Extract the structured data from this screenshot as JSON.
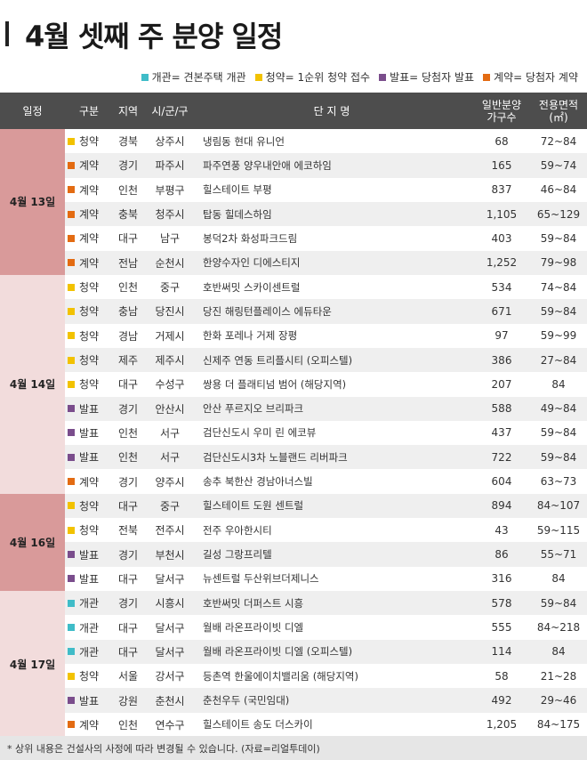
{
  "title": "4월 셋째 주 분양 일정",
  "legend": [
    {
      "color": "#3fbcc8",
      "label": "개관= 견본주택 개관"
    },
    {
      "color": "#f2c200",
      "label": "청약= 1순위 청약 접수"
    },
    {
      "color": "#7a4d8c",
      "label": "발표= 당첨자 발표"
    },
    {
      "color": "#e36b12",
      "label": "계약= 당첨자 계약"
    }
  ],
  "type_colors": {
    "개관": "#3fbcc8",
    "청약": "#f2c200",
    "발표": "#7a4d8c",
    "계약": "#e36b12"
  },
  "headers": {
    "date": "일정",
    "type": "구분",
    "region": "지역",
    "city": "시/군/구",
    "name": "단 지 명",
    "units_line1": "일반분양",
    "units_line2": "가구수",
    "area_line1": "전용면적",
    "area_line2": "(㎡)"
  },
  "groups": [
    {
      "date": "4월 13일",
      "shade": "dark",
      "rows": [
        {
          "type": "청약",
          "region": "경북",
          "city": "상주시",
          "name": "냉림동 현대 유니언",
          "units": "68",
          "area": "72~84"
        },
        {
          "type": "계약",
          "region": "경기",
          "city": "파주시",
          "name": "파주연풍 양우내안애 에코하임",
          "units": "165",
          "area": "59~74"
        },
        {
          "type": "계약",
          "region": "인천",
          "city": "부평구",
          "name": "힐스테이트 부평",
          "units": "837",
          "area": "46~84"
        },
        {
          "type": "계약",
          "region": "충북",
          "city": "청주시",
          "name": "탑동 힐데스하임",
          "units": "1,105",
          "area": "65~129"
        },
        {
          "type": "계약",
          "region": "대구",
          "city": "남구",
          "name": "봉덕2차 화성파크드림",
          "units": "403",
          "area": "59~84"
        },
        {
          "type": "계약",
          "region": "전남",
          "city": "순천시",
          "name": "한양수자인 디에스티지",
          "units": "1,252",
          "area": "79~98"
        }
      ]
    },
    {
      "date": "4월 14일",
      "shade": "light",
      "rows": [
        {
          "type": "청약",
          "region": "인천",
          "city": "중구",
          "name": "호반써밋 스카이센트럴",
          "units": "534",
          "area": "74~84"
        },
        {
          "type": "청약",
          "region": "충남",
          "city": "당진시",
          "name": "당진 해링턴플레이스 에듀타운",
          "units": "671",
          "area": "59~84"
        },
        {
          "type": "청약",
          "region": "경남",
          "city": "거제시",
          "name": "한화 포레나 거제 장평",
          "units": "97",
          "area": "59~99"
        },
        {
          "type": "청약",
          "region": "제주",
          "city": "제주시",
          "name": "신제주 연동 트리플시티 (오피스텔)",
          "units": "386",
          "area": "27~84"
        },
        {
          "type": "청약",
          "region": "대구",
          "city": "수성구",
          "name": "쌍용 더 플래티넘 범어 (해당지역)",
          "units": "207",
          "area": "84"
        },
        {
          "type": "발표",
          "region": "경기",
          "city": "안산시",
          "name": "안산 푸르지오 브리파크",
          "units": "588",
          "area": "49~84"
        },
        {
          "type": "발표",
          "region": "인천",
          "city": "서구",
          "name": "검단신도시 우미 린 에코뷰",
          "units": "437",
          "area": "59~84"
        },
        {
          "type": "발표",
          "region": "인천",
          "city": "서구",
          "name": "검단신도시3차 노블랜드 리버파크",
          "units": "722",
          "area": "59~84"
        },
        {
          "type": "계약",
          "region": "경기",
          "city": "양주시",
          "name": "송추 북한산 경남아너스빌",
          "units": "604",
          "area": "63~73"
        }
      ]
    },
    {
      "date": "4월 16일",
      "shade": "dark",
      "rows": [
        {
          "type": "청약",
          "region": "대구",
          "city": "중구",
          "name": "힐스테이트 도원 센트럴",
          "units": "894",
          "area": "84~107"
        },
        {
          "type": "청약",
          "region": "전북",
          "city": "전주시",
          "name": "전주 우아한시티",
          "units": "43",
          "area": "59~115"
        },
        {
          "type": "발표",
          "region": "경기",
          "city": "부천시",
          "name": "길성 그랑프리텔",
          "units": "86",
          "area": "55~71"
        },
        {
          "type": "발표",
          "region": "대구",
          "city": "달서구",
          "name": "뉴센트럴 두산위브더제니스",
          "units": "316",
          "area": "84"
        }
      ]
    },
    {
      "date": "4월 17일",
      "shade": "light",
      "rows": [
        {
          "type": "개관",
          "region": "경기",
          "city": "시흥시",
          "name": "호반써밋 더퍼스트 시흥",
          "units": "578",
          "area": "59~84"
        },
        {
          "type": "개관",
          "region": "대구",
          "city": "달서구",
          "name": "월배 라온프라이빗 디엘",
          "units": "555",
          "area": "84~218"
        },
        {
          "type": "개관",
          "region": "대구",
          "city": "달서구",
          "name": "월배 라온프라이빗 디엘 (오피스텔)",
          "units": "114",
          "area": "84"
        },
        {
          "type": "청약",
          "region": "서울",
          "city": "강서구",
          "name": "등촌역 한울에이치밸리움 (해당지역)",
          "units": "58",
          "area": "21~28"
        },
        {
          "type": "발표",
          "region": "강원",
          "city": "춘천시",
          "name": "춘천우두 (국민임대)",
          "units": "492",
          "area": "29~46"
        },
        {
          "type": "계약",
          "region": "인천",
          "city": "연수구",
          "name": "힐스테이트 송도 더스카이",
          "units": "1,205",
          "area": "84~175"
        }
      ]
    }
  ],
  "footer": "* 상위 내용은 건설사의 사정에 따라 변경될 수 있습니다. (자료=리얼투데이)"
}
